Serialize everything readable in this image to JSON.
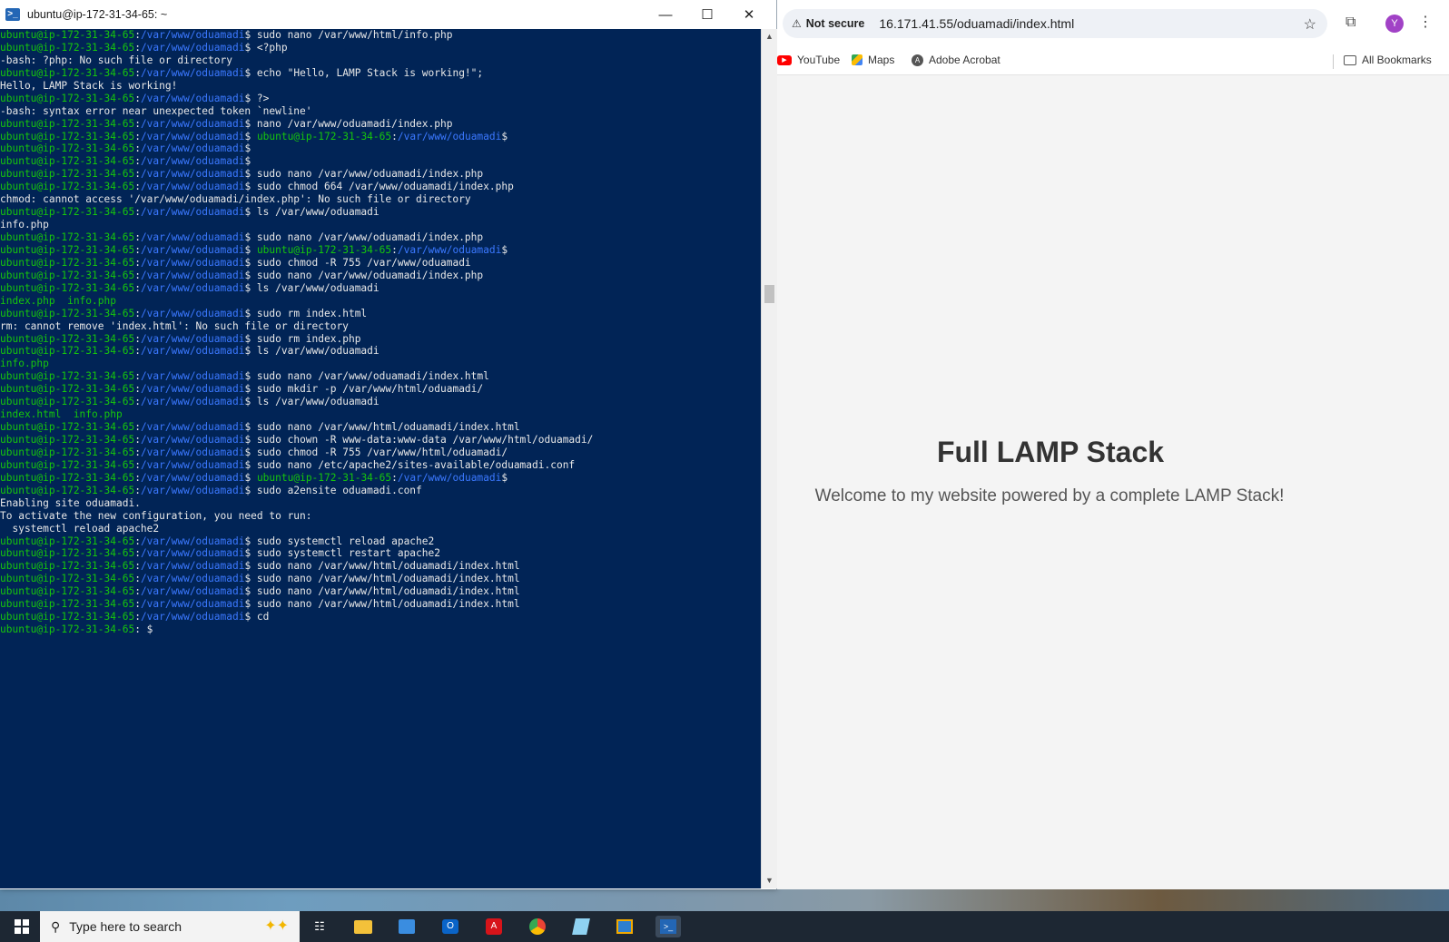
{
  "terminal": {
    "title": "ubuntu@ip-172-31-34-65: ~",
    "prompt_user": "ubuntu@ip-172-31-34-65",
    "prompt_path": "/var/www/oduamadi",
    "lines": [
      {
        "t": "p",
        "cmd": "sudo nano /var/www/html/info.php"
      },
      {
        "t": "p",
        "cmd": "<?php"
      },
      {
        "t": "o",
        "text": "-bash: ?php: No such file or directory"
      },
      {
        "t": "p",
        "cmd": "echo \"Hello, LAMP Stack is working!\";"
      },
      {
        "t": "o",
        "text": "Hello, LAMP Stack is working!"
      },
      {
        "t": "p",
        "cmd": "?>"
      },
      {
        "t": "o",
        "text": "-bash: syntax error near unexpected token `newline'"
      },
      {
        "t": "p",
        "cmd": "nano /var/www/oduamadi/index.php"
      },
      {
        "t": "pp",
        "cmd": ""
      },
      {
        "t": "p",
        "cmd": ""
      },
      {
        "t": "p",
        "cmd": ""
      },
      {
        "t": "p",
        "cmd": "sudo nano /var/www/oduamadi/index.php"
      },
      {
        "t": "p",
        "cmd": "sudo chmod 664 /var/www/oduamadi/index.php"
      },
      {
        "t": "o",
        "text": "chmod: cannot access '/var/www/oduamadi/index.php': No such file or directory"
      },
      {
        "t": "p",
        "cmd": "ls /var/www/oduamadi"
      },
      {
        "t": "o",
        "text": "info.php"
      },
      {
        "t": "p",
        "cmd": "sudo nano /var/www/oduamadi/index.php"
      },
      {
        "t": "pp",
        "cmd": ""
      },
      {
        "t": "p",
        "cmd": "sudo chmod -R 755 /var/www/oduamadi"
      },
      {
        "t": "p",
        "cmd": "sudo nano /var/www/oduamadi/index.php"
      },
      {
        "t": "p",
        "cmd": "ls /var/www/oduamadi"
      },
      {
        "t": "g",
        "text": "index.php  info.php"
      },
      {
        "t": "p",
        "cmd": "sudo rm index.html"
      },
      {
        "t": "o",
        "text": "rm: cannot remove 'index.html': No such file or directory"
      },
      {
        "t": "p",
        "cmd": "sudo rm index.php"
      },
      {
        "t": "p",
        "cmd": "ls /var/www/oduamadi"
      },
      {
        "t": "g",
        "text": "info.php"
      },
      {
        "t": "p",
        "cmd": "sudo nano /var/www/oduamadi/index.html"
      },
      {
        "t": "p",
        "cmd": "sudo mkdir -p /var/www/html/oduamadi/"
      },
      {
        "t": "p",
        "cmd": "ls /var/www/oduamadi"
      },
      {
        "t": "g",
        "text": "index.html  info.php"
      },
      {
        "t": "p",
        "cmd": "sudo nano /var/www/html/oduamadi/index.html"
      },
      {
        "t": "p",
        "cmd": "sudo chown -R www-data:www-data /var/www/html/oduamadi/"
      },
      {
        "t": "p",
        "cmd": "sudo chmod -R 755 /var/www/html/oduamadi/"
      },
      {
        "t": "p",
        "cmd": "sudo nano /etc/apache2/sites-available/oduamadi.conf"
      },
      {
        "t": "pp",
        "cmd": ""
      },
      {
        "t": "p",
        "cmd": "sudo a2ensite oduamadi.conf"
      },
      {
        "t": "o",
        "text": "Enabling site oduamadi."
      },
      {
        "t": "o",
        "text": "To activate the new configuration, you need to run:"
      },
      {
        "t": "o",
        "text": "  systemctl reload apache2"
      },
      {
        "t": "p",
        "cmd": "sudo systemctl reload apache2"
      },
      {
        "t": "p",
        "cmd": "sudo systemctl restart apache2"
      },
      {
        "t": "p",
        "cmd": "sudo nano /var/www/html/oduamadi/index.html"
      },
      {
        "t": "p",
        "cmd": "sudo nano /var/www/html/oduamadi/index.html"
      },
      {
        "t": "p",
        "cmd": "sudo nano /var/www/html/oduamadi/index.html"
      },
      {
        "t": "p",
        "cmd": "sudo nano /var/www/html/oduamadi/index.html"
      },
      {
        "t": "p",
        "cmd": "cd"
      },
      {
        "t": "home",
        "cmd": ""
      }
    ]
  },
  "browser": {
    "not_secure": "Not secure",
    "url": "16.171.41.55/oduamadi/index.html",
    "avatar_letter": "Y",
    "bookmarks": [
      "YouTube",
      "Maps",
      "Adobe Acrobat"
    ],
    "all_bookmarks": "All Bookmarks",
    "page_heading": "Full LAMP Stack",
    "page_text": "Welcome to my website powered by a complete LAMP Stack!"
  },
  "taskbar": {
    "search_placeholder": "Type here to search"
  },
  "colors": {
    "terminal_bg": "#012456",
    "prompt_user": "#16c60c",
    "prompt_path": "#3b78ff"
  }
}
